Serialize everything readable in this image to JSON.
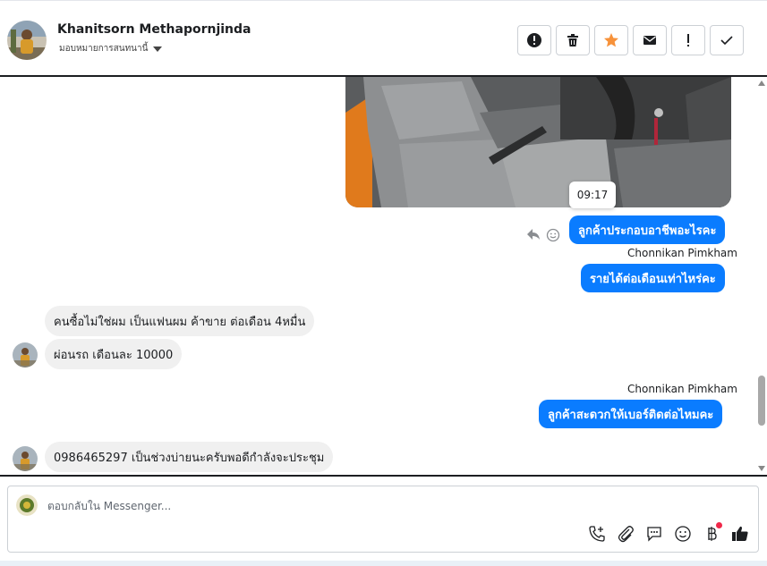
{
  "header": {
    "contact_name": "Khanitsorn Methapornjinda",
    "assign_label": "มอบหมายการสนทนานี้",
    "actions": [
      {
        "name": "report-spam-button",
        "icon": "alert-circle-icon"
      },
      {
        "name": "delete-button",
        "icon": "trash-icon"
      },
      {
        "name": "star-button",
        "icon": "star-icon",
        "color": "#f7923a"
      },
      {
        "name": "mark-unread-button",
        "icon": "envelope-icon"
      },
      {
        "name": "follow-up-button",
        "icon": "exclamation-icon"
      },
      {
        "name": "mark-done-button",
        "icon": "checkmark-icon"
      }
    ]
  },
  "messages": {
    "photo_time": "09:17",
    "outgoing_1": "ลูกค้าประกอบอาชีพอะไรคะ",
    "sender_1": "Chonnikan Pimkham",
    "outgoing_2": "รายได้ต่อเดือนเท่าไหร่คะ",
    "incoming_1": "คนซื้อไม่ใช่ผม เป็นแฟนผม ค้าขาย ต่อเดือน 4หมื่น",
    "incoming_2": "ผ่อนรถ เดือนละ 10000",
    "sender_2": "Chonnikan Pimkham",
    "outgoing_3": "ลูกค้าสะดวกให้เบอร์ติดต่อไหมคะ",
    "incoming_3": "0986465297 เป็นช่วงบ่ายนะครับพอดีกำลังจะประชุม"
  },
  "composer": {
    "placeholder": "ตอบกลับใน Messenger...",
    "tools": [
      "phone-add-icon",
      "paperclip-icon",
      "saved-reply-icon",
      "emoji-icon",
      "baht-icon",
      "thumbs-up-icon"
    ]
  },
  "colors": {
    "outgoing_bubble": "#0a7cff",
    "incoming_bubble": "#f0f0f0",
    "star": "#f7923a",
    "notification_dot": "#f02849"
  }
}
